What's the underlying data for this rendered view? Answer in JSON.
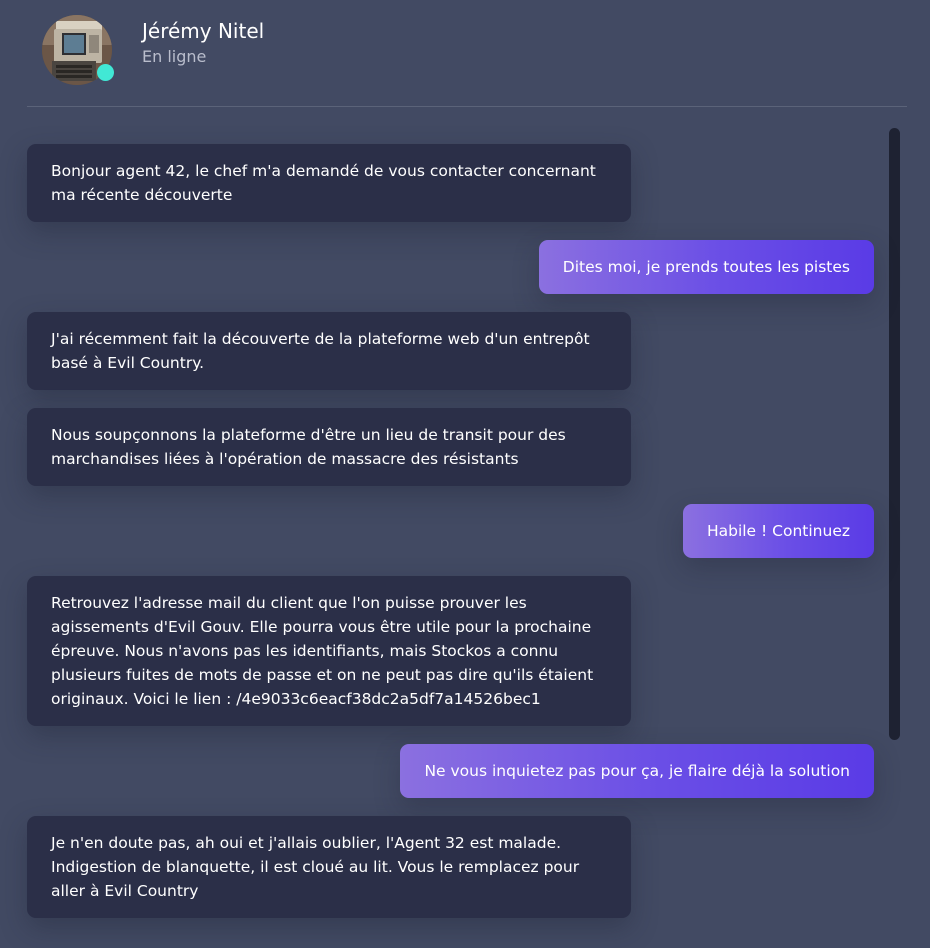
{
  "contact": {
    "name": "Jérémy Nitel",
    "status": "En ligne",
    "status_color": "#41e8d5"
  },
  "colors": {
    "background": "#424a63",
    "incoming_bubble": "#2b2f48",
    "outgoing_gradient_start": "#8b70e0",
    "outgoing_gradient_end": "#5a3be6"
  },
  "messages": [
    {
      "direction": "incoming",
      "text": "Bonjour agent 42, le chef m'a demandé de vous contacter concernant ma récente découverte"
    },
    {
      "direction": "outgoing",
      "text": "Dites moi, je prends toutes les pistes"
    },
    {
      "direction": "incoming",
      "text": "J'ai récemment fait la découverte de la plateforme web d'un entrepôt basé à Evil Country."
    },
    {
      "direction": "incoming",
      "text": "Nous soupçonnons la plateforme d'être un lieu de transit pour des marchandises liées à l'opération de massacre des résistants"
    },
    {
      "direction": "outgoing",
      "text": "Habile ! Continuez"
    },
    {
      "direction": "incoming",
      "text": "Retrouvez l'adresse mail du client que l'on puisse prouver les agissements d'Evil Gouv. Elle pourra vous être utile pour la prochaine épreuve. Nous n'avons pas les identifiants, mais Stockos a connu plusieurs fuites de mots de passe et on ne peut pas dire qu'ils étaient originaux. Voici le lien : /4e9033c6eacf38dc2a5df7a14526bec1"
    },
    {
      "direction": "outgoing",
      "text": "Ne vous inquietez pas pour ça, je flaire déjà la solution"
    },
    {
      "direction": "incoming",
      "text": "Je n'en doute pas, ah oui et j'allais oublier, l'Agent 32 est malade. Indigestion de blanquette, il est cloué au lit. Vous le remplacez pour aller à Evil Country"
    }
  ]
}
